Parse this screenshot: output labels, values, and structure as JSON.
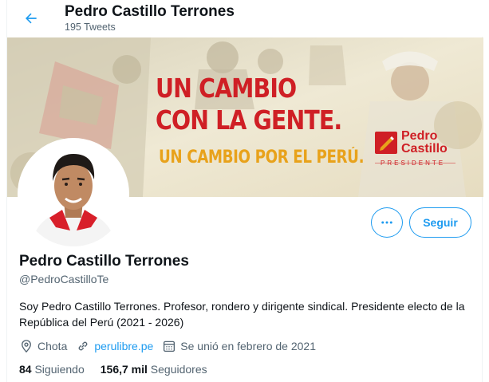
{
  "header": {
    "name": "Pedro Castillo Terrones",
    "tweet_count": "195 Tweets"
  },
  "banner": {
    "headline_line1": "UN CAMBIO",
    "headline_line2": "CON LA GENTE.",
    "subline": "UN CAMBIO POR EL PERÚ.",
    "logo_line1": "Pedro",
    "logo_line2": "Castillo",
    "logo_role": "PRESIDENTE"
  },
  "actions": {
    "more_icon": "more-horizontal-icon",
    "follow_label": "Seguir"
  },
  "profile": {
    "display_name": "Pedro Castillo Terrones",
    "handle": "@PedroCastilloTe",
    "bio": "Soy Pedro Castillo Terrones. Profesor, rondero y dirigente sindical. Presidente electo de la República del Perú (2021 - 2026)",
    "location": "Chota",
    "website": "perulibre.pe",
    "joined": "Se unió en febrero de 2021"
  },
  "stats": {
    "following_count": "84",
    "following_label": "Siguiendo",
    "followers_count": "156,7 mil",
    "followers_label": "Seguidores"
  },
  "colors": {
    "accent": "#1d9bf0",
    "banner_red": "#cf1f25",
    "banner_gold": "#e8a21b",
    "secondary_text": "#536471"
  }
}
